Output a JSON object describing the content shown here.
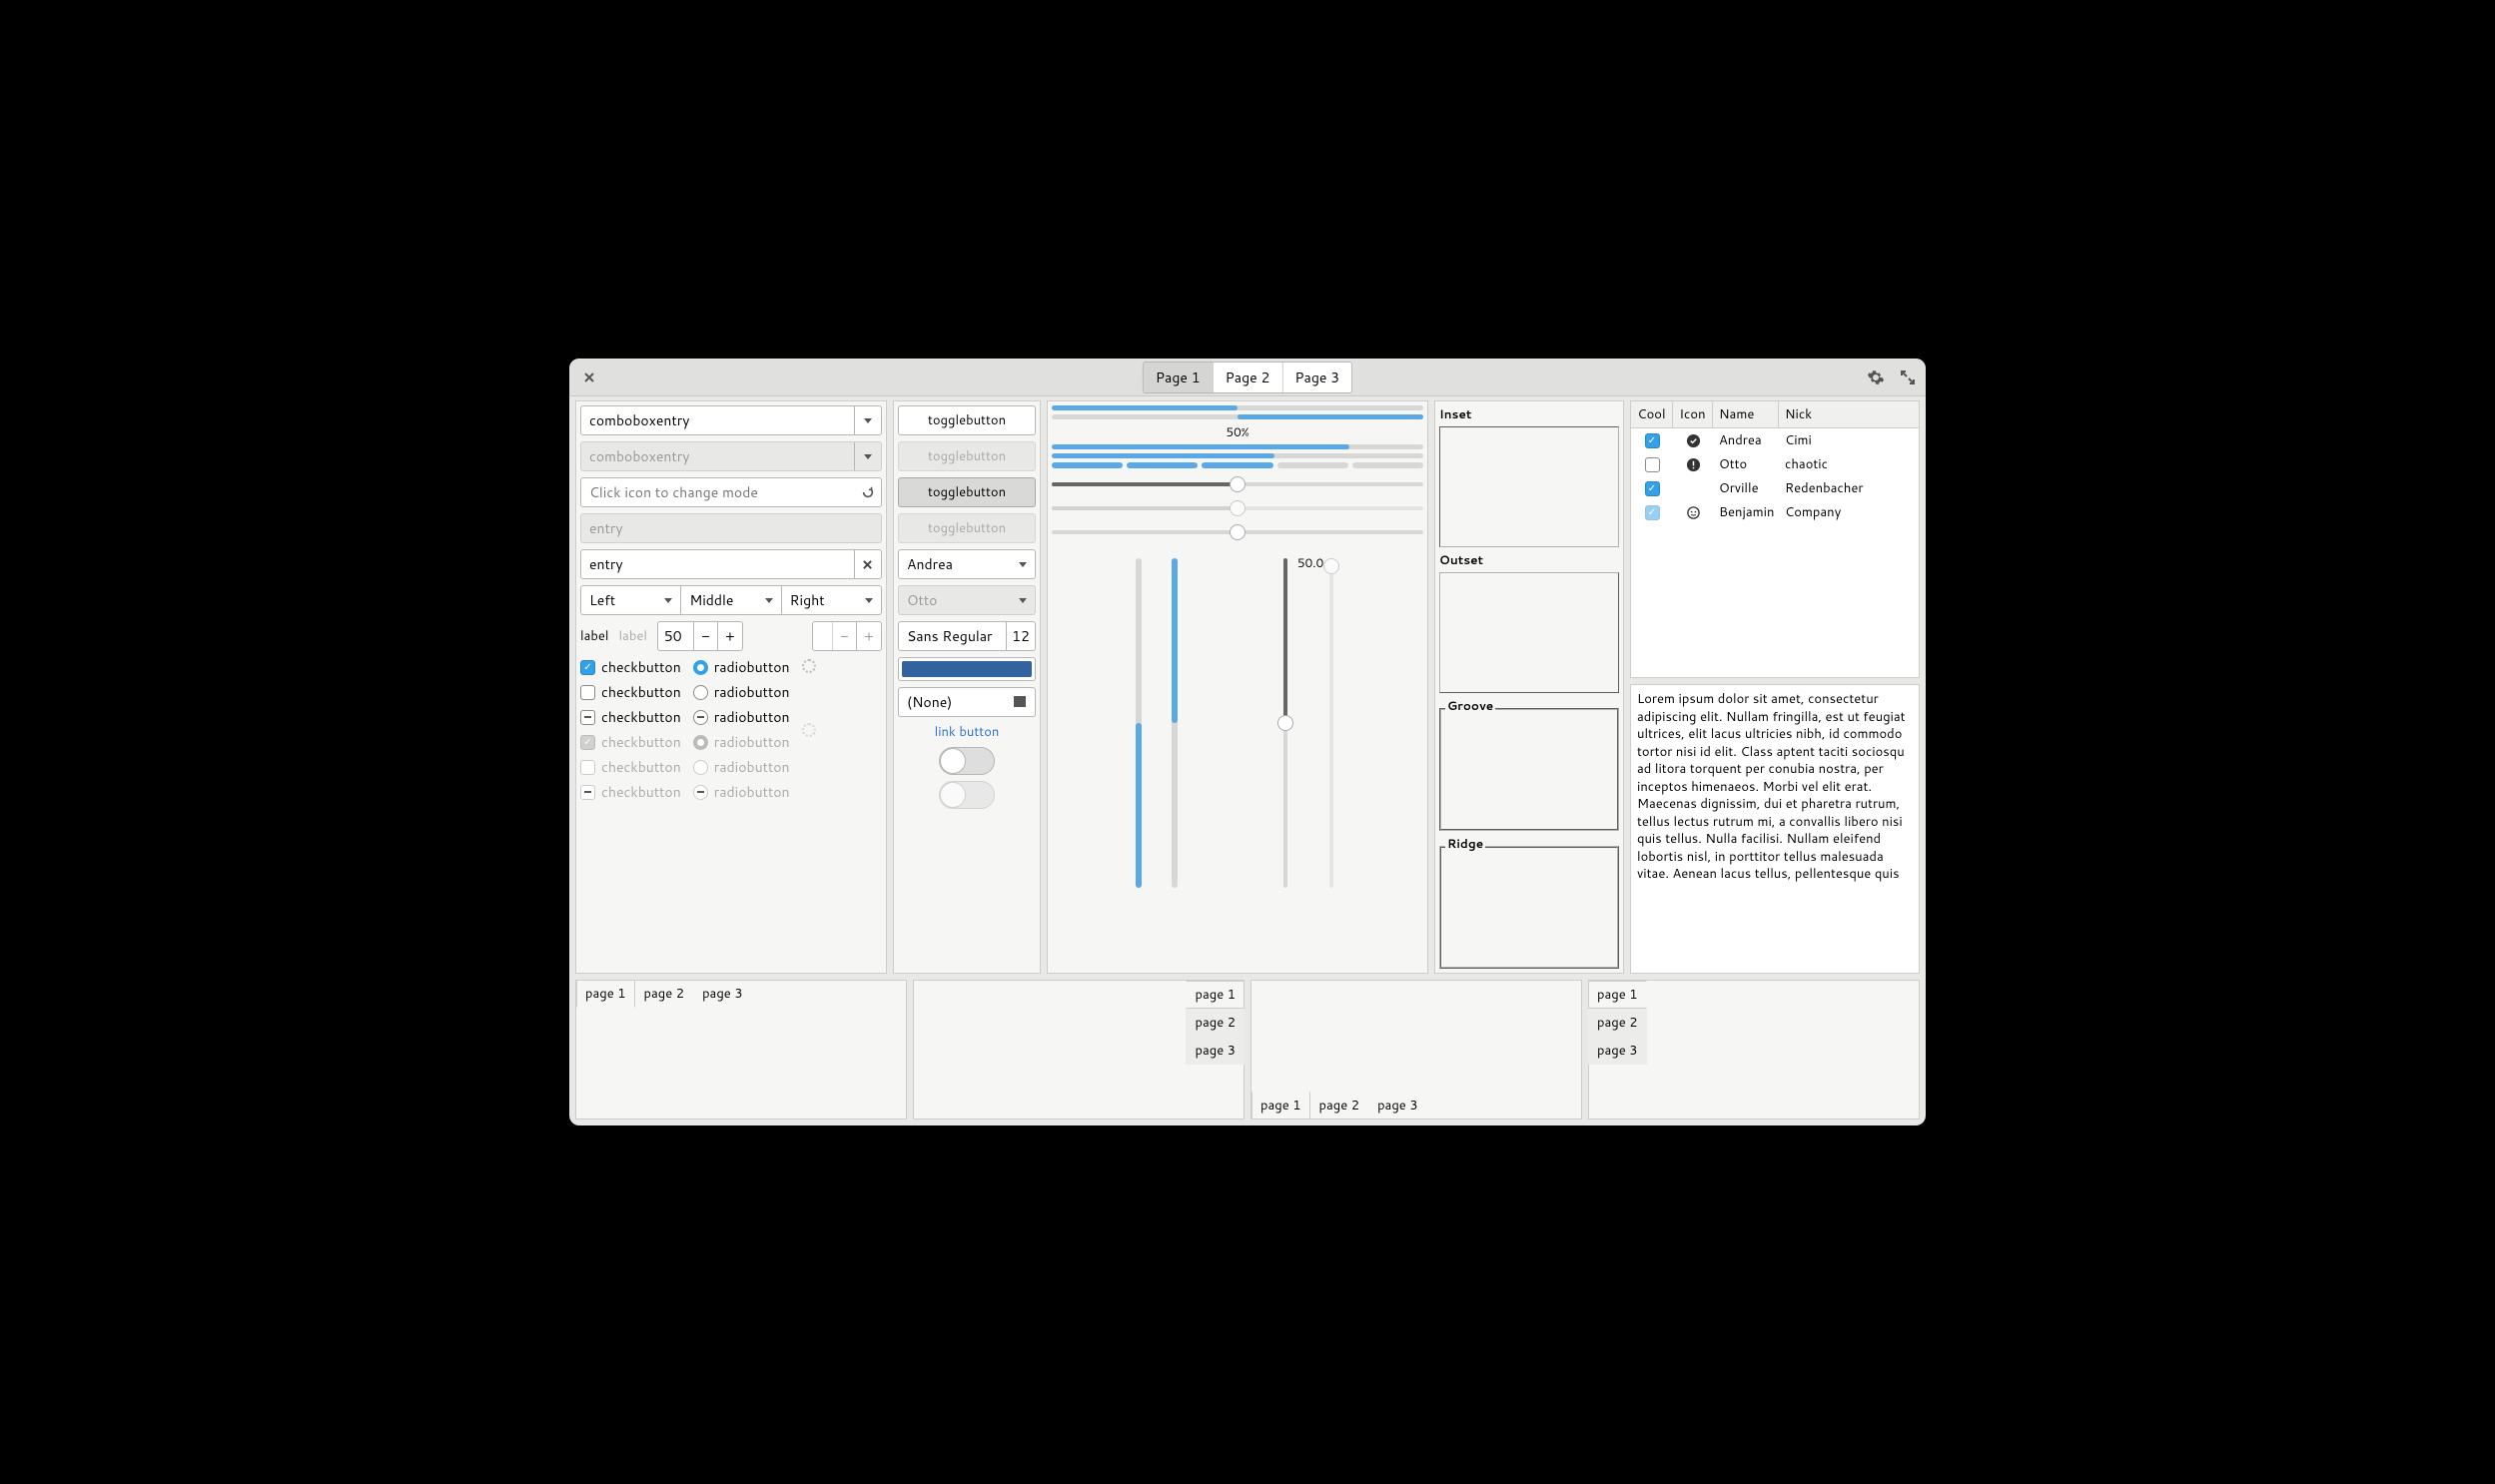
{
  "titlebar": {
    "pages": [
      "Page 1",
      "Page 2",
      "Page 3"
    ],
    "active_page": 0
  },
  "col1": {
    "combo1": "comboboxentry",
    "combo2": "comboboxentry",
    "mode_entry_placeholder": "Click icon to change mode",
    "entry_disabled": "entry",
    "entry_clearable": "entry",
    "linked": [
      "Left",
      "Middle",
      "Right"
    ],
    "label1": "label",
    "label2": "label",
    "spin_value": "50",
    "check_label": "checkbutton",
    "radio_label": "radiobutton"
  },
  "col2": {
    "toggle_label": "togglebutton",
    "combo1": "Andrea",
    "combo2": "Otto",
    "font_name": "Sans Regular",
    "font_size": "12",
    "color": "#33639e",
    "file_label": "(None)",
    "link_label": "link button"
  },
  "col3": {
    "pc_text": "50%",
    "vscale_label": "50.0"
  },
  "frames": {
    "inset": "Inset",
    "outset": "Outset",
    "groove": "Groove",
    "ridge": "Ridge"
  },
  "treeview": {
    "columns": [
      "Cool",
      "Icon",
      "Name",
      "Nick"
    ],
    "rows": [
      {
        "cool": true,
        "cool_disabled": false,
        "icon": "check-circle",
        "name": "Andrea",
        "nick": "Cimi"
      },
      {
        "cool": false,
        "cool_disabled": false,
        "icon": "warn-circle",
        "name": "Otto",
        "nick": "chaotic"
      },
      {
        "cool": true,
        "cool_disabled": false,
        "icon": "moon",
        "name": "Orville",
        "nick": "Redenbacher"
      },
      {
        "cool": true,
        "cool_disabled": true,
        "icon": "face",
        "name": "Benjamin",
        "nick": "Company"
      }
    ]
  },
  "lorem": "Lorem ipsum dolor sit amet, consectetur adipiscing elit.\nNullam fringilla, est ut feugiat ultrices, elit lacus ultricies nibh, id commodo tortor nisi id elit.\nClass aptent taciti sociosqu ad litora torquent per conubia nostra, per inceptos himenaeos.\nMorbi vel elit erat. Maecenas dignissim, dui et pharetra rutrum, tellus lectus rutrum mi, a convallis libero nisi quis tellus.\nNulla facilisi. Nullam eleifend lobortis nisl, in porttitor tellus malesuada vitae.\nAenean lacus tellus, pellentesque quis",
  "notebook_tabs": [
    "page 1",
    "page 2",
    "page 3"
  ]
}
